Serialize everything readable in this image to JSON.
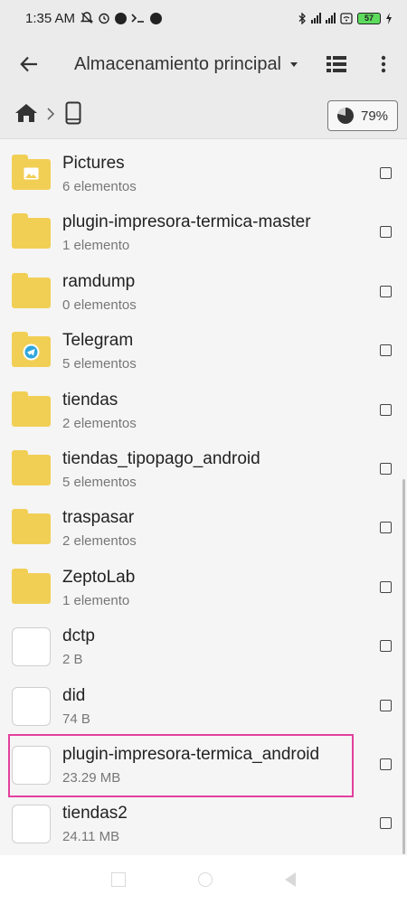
{
  "status": {
    "time": "1:35 AM",
    "battery": "57"
  },
  "toolbar": {
    "title": "Almacenamiento principal"
  },
  "breadcrumb": {
    "storage_percent": "79%"
  },
  "items": [
    {
      "name": "Pictures",
      "meta": "6 elementos",
      "kind": "folder-pictures"
    },
    {
      "name": "plugin-impresora-termica-master",
      "meta": "1 elemento",
      "kind": "folder"
    },
    {
      "name": "ramdump",
      "meta": "0 elementos",
      "kind": "folder"
    },
    {
      "name": "Telegram",
      "meta": "5 elementos",
      "kind": "folder-telegram"
    },
    {
      "name": "tiendas",
      "meta": "2 elementos",
      "kind": "folder"
    },
    {
      "name": "tiendas_tipopago_android",
      "meta": "5 elementos",
      "kind": "folder"
    },
    {
      "name": "traspasar",
      "meta": "2 elementos",
      "kind": "folder"
    },
    {
      "name": "ZeptoLab",
      "meta": "1 elemento",
      "kind": "folder"
    },
    {
      "name": "dctp",
      "meta": "2 B",
      "kind": "file"
    },
    {
      "name": "did",
      "meta": "74 B",
      "kind": "file"
    },
    {
      "name": "plugin-impresora-termica_android",
      "meta": "23.29 MB",
      "kind": "file"
    },
    {
      "name": "tiendas2",
      "meta": "24.11 MB",
      "kind": "file"
    }
  ]
}
